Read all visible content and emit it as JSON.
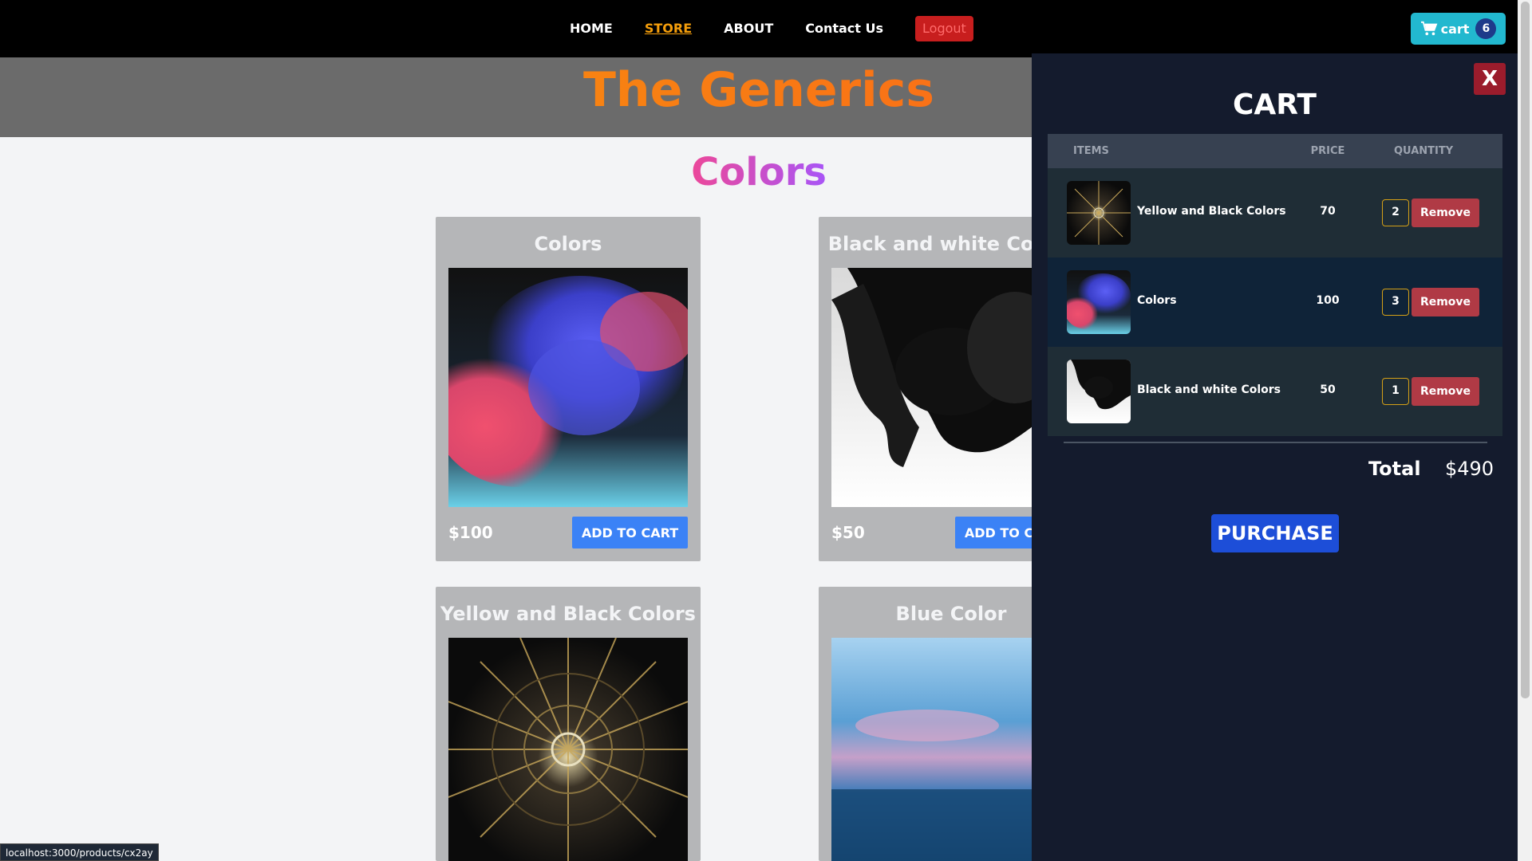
{
  "nav": {
    "links": [
      "HOME",
      "STORE",
      "ABOUT",
      "Contact Us"
    ],
    "logout": "Logout",
    "cart_label": "cart",
    "cart_count": "6"
  },
  "hero": {
    "title": "The Generics"
  },
  "store": {
    "section_title": "Colors",
    "products": [
      {
        "title": "Colors",
        "price": "$100",
        "button": "ADD TO CART",
        "image": "colorful-smoke-image"
      },
      {
        "title": "Black and white Colors",
        "price": "$50",
        "button": "ADD TO CART",
        "image": "black-ink-image"
      },
      {
        "title": "Yellow and Black Colors",
        "price": "",
        "button": "",
        "image": "radial-lights-image"
      },
      {
        "title": "Blue Color",
        "price": "",
        "button": "",
        "image": "blue-bokeh-image"
      }
    ]
  },
  "cart": {
    "title": "CART",
    "close_label": "X",
    "headers": [
      "ITEMS",
      "PRICE",
      "QUANTITY"
    ],
    "items": [
      {
        "name": "Yellow and Black Colors",
        "price": "70",
        "quantity": "2",
        "remove": "Remove"
      },
      {
        "name": "Colors",
        "price": "100",
        "quantity": "3",
        "remove": "Remove"
      },
      {
        "name": "Black and white Colors",
        "price": "50",
        "quantity": "1",
        "remove": "Remove"
      }
    ],
    "total_label": "Total",
    "total_value": "$490",
    "purchase": "PURCHASE"
  },
  "status_bar": "localhost:3000/products/cx2ay",
  "colors": {
    "accent": "#f59e0b",
    "cart_button": "#22b8cf",
    "add_button": "#3b82f6",
    "remove_button": "#b03a45",
    "purchase_button": "#1d4ed8"
  }
}
